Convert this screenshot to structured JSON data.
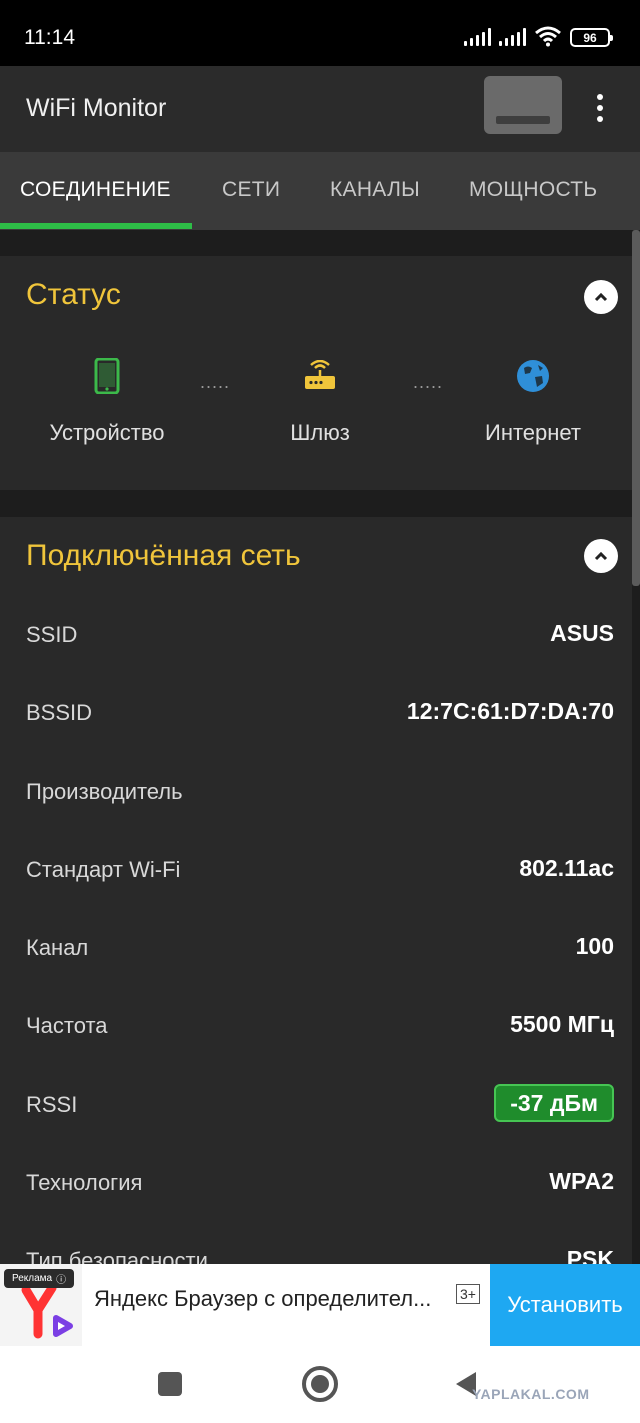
{
  "status_bar": {
    "time": "11:14",
    "battery": "96"
  },
  "app": {
    "title": "WiFi Monitor"
  },
  "tabs": [
    {
      "label": "СОЕДИНЕНИЕ",
      "active": true
    },
    {
      "label": "СЕТИ",
      "active": false
    },
    {
      "label": "КАНАЛЫ",
      "active": false
    },
    {
      "label": "МОЩНОСТЬ",
      "active": false
    }
  ],
  "status_card": {
    "title": "Статус",
    "nodes": [
      {
        "label": "Устройство",
        "icon": "phone-icon",
        "color": "#3cb94a"
      },
      {
        "label": "Шлюз",
        "icon": "router-icon",
        "color": "#f0c53b"
      },
      {
        "label": "Интернет",
        "icon": "globe-icon",
        "color": "#2f8fd8"
      }
    ],
    "dots": "....."
  },
  "network_card": {
    "title": "Подключённая сеть",
    "rows": [
      {
        "label": "SSID",
        "value": "ASUS"
      },
      {
        "label": "BSSID",
        "value": "12:7C:61:D7:DA:70"
      },
      {
        "label": "Производитель",
        "value": ""
      },
      {
        "label": "Стандарт Wi-Fi",
        "value": "802.11ac"
      },
      {
        "label": "Канал",
        "value": "100"
      },
      {
        "label": "Частота",
        "value": "5500 МГц"
      },
      {
        "label": "RSSI",
        "value": "-37 дБм"
      },
      {
        "label": "Технология",
        "value": "WPA2"
      },
      {
        "label": "Тип безопасности",
        "value": "PSK"
      }
    ]
  },
  "ad": {
    "badge": "Реклама",
    "text": "Яндекс Браузер с определител...",
    "age": "3+",
    "cta": "Установить"
  },
  "watermark": "YAPLAKAL.COM",
  "colors": {
    "accent": "#2ebd47",
    "title": "#f0c53b",
    "rssi_good": "#1f8c2c",
    "cta": "#1ea8f2"
  }
}
